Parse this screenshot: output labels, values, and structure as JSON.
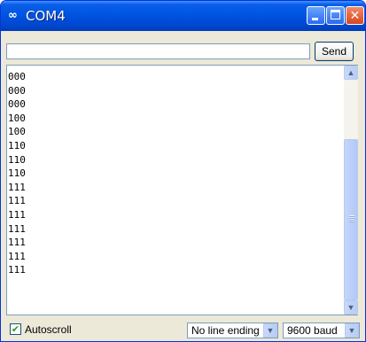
{
  "window": {
    "title": "COM4",
    "app_icon": "infinity-icon",
    "controls": {
      "minimize_icon": "minimize-icon",
      "maximize_icon": "maximize-icon",
      "close_icon": "close-icon"
    }
  },
  "send_bar": {
    "input_value": "",
    "send_label": "Send"
  },
  "output": {
    "lines": [
      "000",
      "000",
      "000",
      "100",
      "100",
      "110",
      "110",
      "110",
      "111",
      "111",
      "111",
      "111",
      "111",
      "111",
      "111"
    ]
  },
  "scrollbar": {
    "up_icon": "arrow-up-icon",
    "down_icon": "arrow-down-icon"
  },
  "status": {
    "autoscroll_label": "Autoscroll",
    "autoscroll_checked": true,
    "line_ending_selected": "No line ending",
    "baud_selected": "9600 baud"
  },
  "colors": {
    "titlebar": "#0054e3",
    "close_button": "#d8461e",
    "checkmark": "#21a121"
  }
}
